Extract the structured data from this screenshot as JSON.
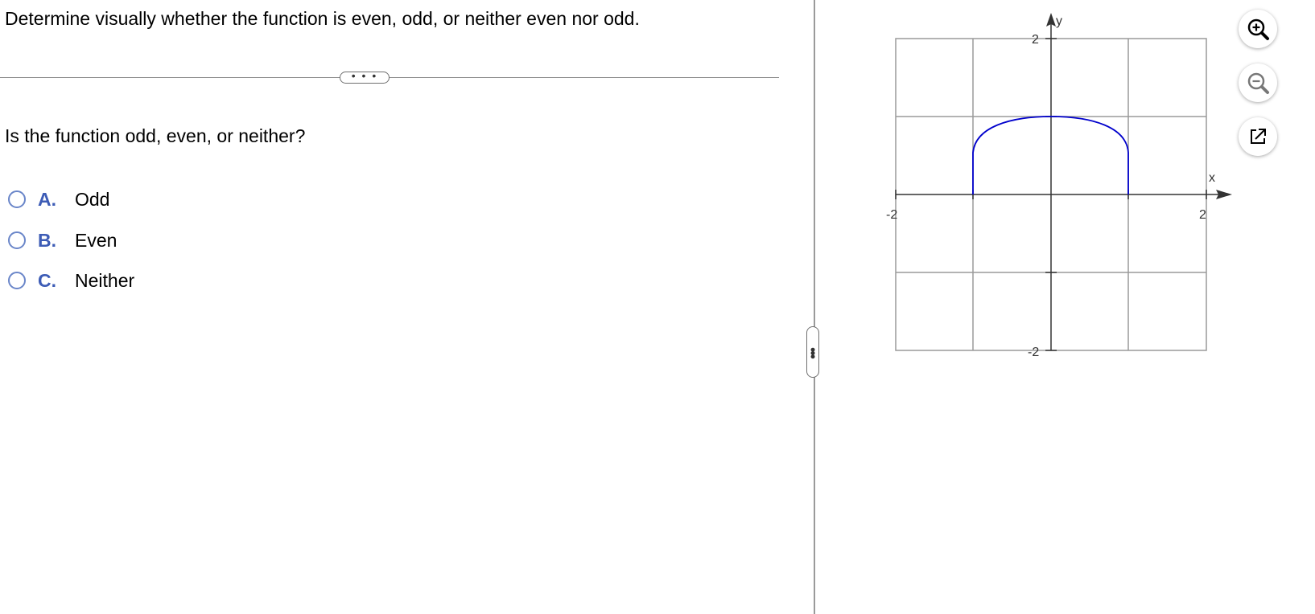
{
  "question": "Determine visually whether the function is even, odd, or neither even nor odd.",
  "more_button": "• • •",
  "prompt": "Is the function odd, even, or neither?",
  "options": [
    {
      "letter": "A.",
      "text": "Odd"
    },
    {
      "letter": "B.",
      "text": "Even"
    },
    {
      "letter": "C.",
      "text": "Neither"
    }
  ],
  "graph": {
    "x_axis_label": "x",
    "y_axis_label": "y",
    "x_min_label": "-2",
    "x_max_label": "2",
    "y_max_label": "2",
    "y_min_label": "-2",
    "curve_color": "#0000cc"
  },
  "tools": [
    {
      "name": "zoom-in-icon"
    },
    {
      "name": "zoom-out-icon"
    },
    {
      "name": "open-external-icon"
    }
  ]
}
